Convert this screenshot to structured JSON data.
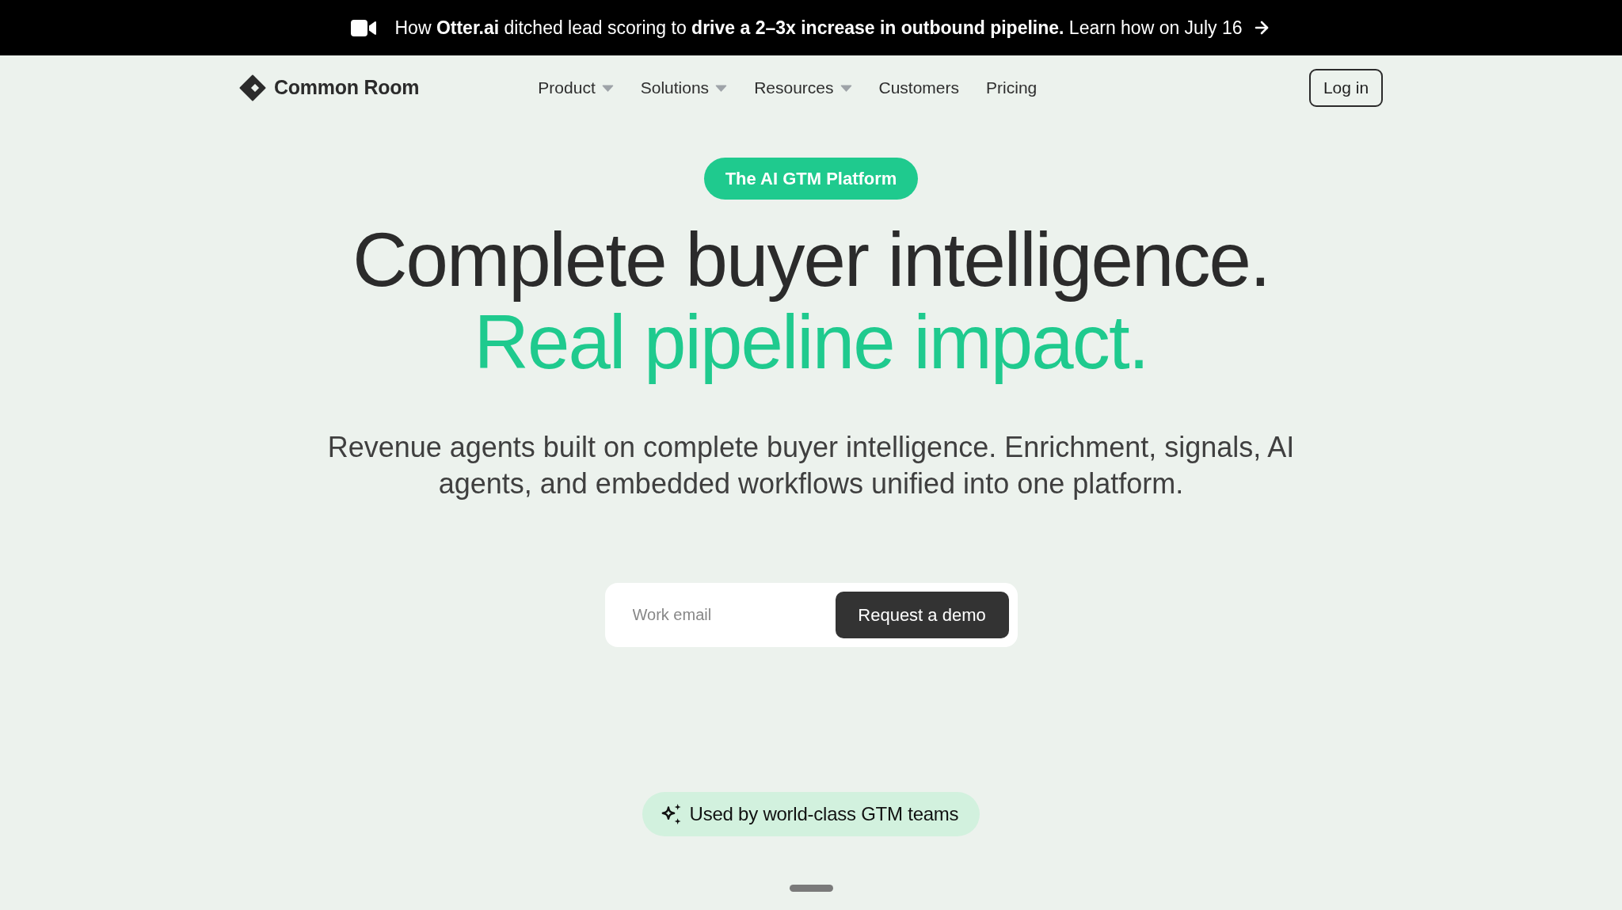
{
  "banner": {
    "text": "How **Otter.ai** ditched lead scoring to **drive a 2–3x increase in outbound pipeline.** Learn how on July 16"
  },
  "nav": {
    "logo_text": "Common Room",
    "items": [
      {
        "label": "Product",
        "kind": "dropdown"
      },
      {
        "label": "Solutions",
        "kind": "dropdown"
      },
      {
        "label": "Resources",
        "kind": "dropdown"
      },
      {
        "label": "Customers",
        "kind": "link"
      },
      {
        "label": "Pricing",
        "kind": "link"
      }
    ],
    "login_button": "Log in"
  },
  "hero": {
    "badge": "The AI GTM Platform",
    "headline": "Complete buyer intelligence.",
    "headline_accent": "Real pipeline impact.",
    "description": "Revenue agents built on complete buyer intelligence. Enrichment, signals, AI agents, and embedded workflows unified into one platform.",
    "email_field": {
      "placeholder": "Work email"
    },
    "cta_button": "Request a demo",
    "social_proof": "Used by world-class GTM teams"
  }
}
